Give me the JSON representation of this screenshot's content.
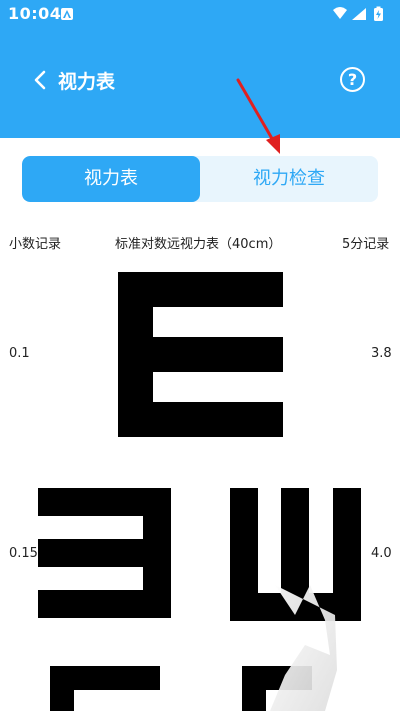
{
  "status_bar": {
    "time": "10:04"
  },
  "app_bar": {
    "title": "视力表",
    "help_symbol": "?"
  },
  "tabs": [
    {
      "label": "视力表",
      "active": true
    },
    {
      "label": "视力检查",
      "active": false
    }
  ],
  "chart_header": {
    "decimal": "小数记录",
    "title": "标准对数远视力表（40cm）",
    "five_point": "5分记录"
  },
  "rows": [
    {
      "decimal": "0.1",
      "five_point": "3.8"
    },
    {
      "decimal": "0.15",
      "five_point": "4.0"
    }
  ],
  "colors": {
    "primary": "#2ea8f5",
    "arrow": "#e02020"
  }
}
